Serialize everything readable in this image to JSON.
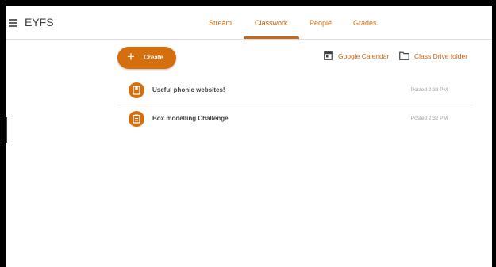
{
  "header": {
    "title": "EYFS",
    "tabs": [
      {
        "label": "Stream"
      },
      {
        "label": "Classwork"
      },
      {
        "label": "People"
      },
      {
        "label": "Grades"
      }
    ],
    "active_tab": "Classwork"
  },
  "toolbar": {
    "create_label": "Create",
    "create_icon": "plus-icon",
    "links": [
      {
        "label": "Google Calendar",
        "icon": "calendar-icon"
      },
      {
        "label": "Class Drive folder",
        "icon": "folder-icon"
      }
    ]
  },
  "classwork": {
    "items": [
      {
        "title": "Useful phonic websites!",
        "posted": "Posted 2:38 PM",
        "icon": "material-icon"
      },
      {
        "title": "Box modelling Challenge",
        "posted": "Posted 2:32 PM",
        "icon": "assignment-icon"
      }
    ]
  },
  "colors": {
    "accent": "#d56e0c",
    "text": "#3c4043",
    "muted": "#9aa0a6"
  }
}
